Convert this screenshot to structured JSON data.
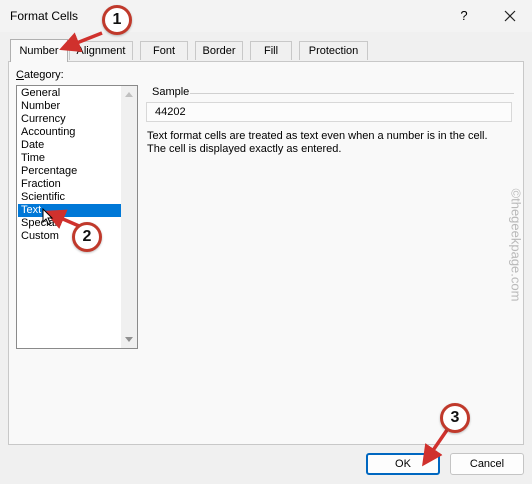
{
  "window": {
    "title": "Format Cells",
    "help_label": "?",
    "close_icon": "close-icon"
  },
  "tabs": [
    {
      "label": "Number",
      "active": true
    },
    {
      "label": "Alignment",
      "active": false
    },
    {
      "label": "Font",
      "active": false
    },
    {
      "label": "Border",
      "active": false
    },
    {
      "label": "Fill",
      "active": false
    },
    {
      "label": "Protection",
      "active": false
    }
  ],
  "category": {
    "label_accel": "C",
    "label_rest": "ategory:",
    "items": [
      "General",
      "Number",
      "Currency",
      "Accounting",
      "Date",
      "Time",
      "Percentage",
      "Fraction",
      "Scientific",
      "Text",
      "Special",
      "Custom"
    ],
    "selected": "Text"
  },
  "sample": {
    "label": "Sample",
    "value": "44202"
  },
  "description": {
    "line1": "Text format cells are treated as text even when a number is in the cell.",
    "line2": "The cell is displayed exactly as entered."
  },
  "buttons": {
    "ok": "OK",
    "cancel": "Cancel"
  },
  "annotations": {
    "step1": "1",
    "step2": "2",
    "step3": "3",
    "color": "#d0312d"
  },
  "watermark": "©thegeekpage.com",
  "colors": {
    "selection": "#0078d7",
    "ok_border": "#0067c0"
  }
}
